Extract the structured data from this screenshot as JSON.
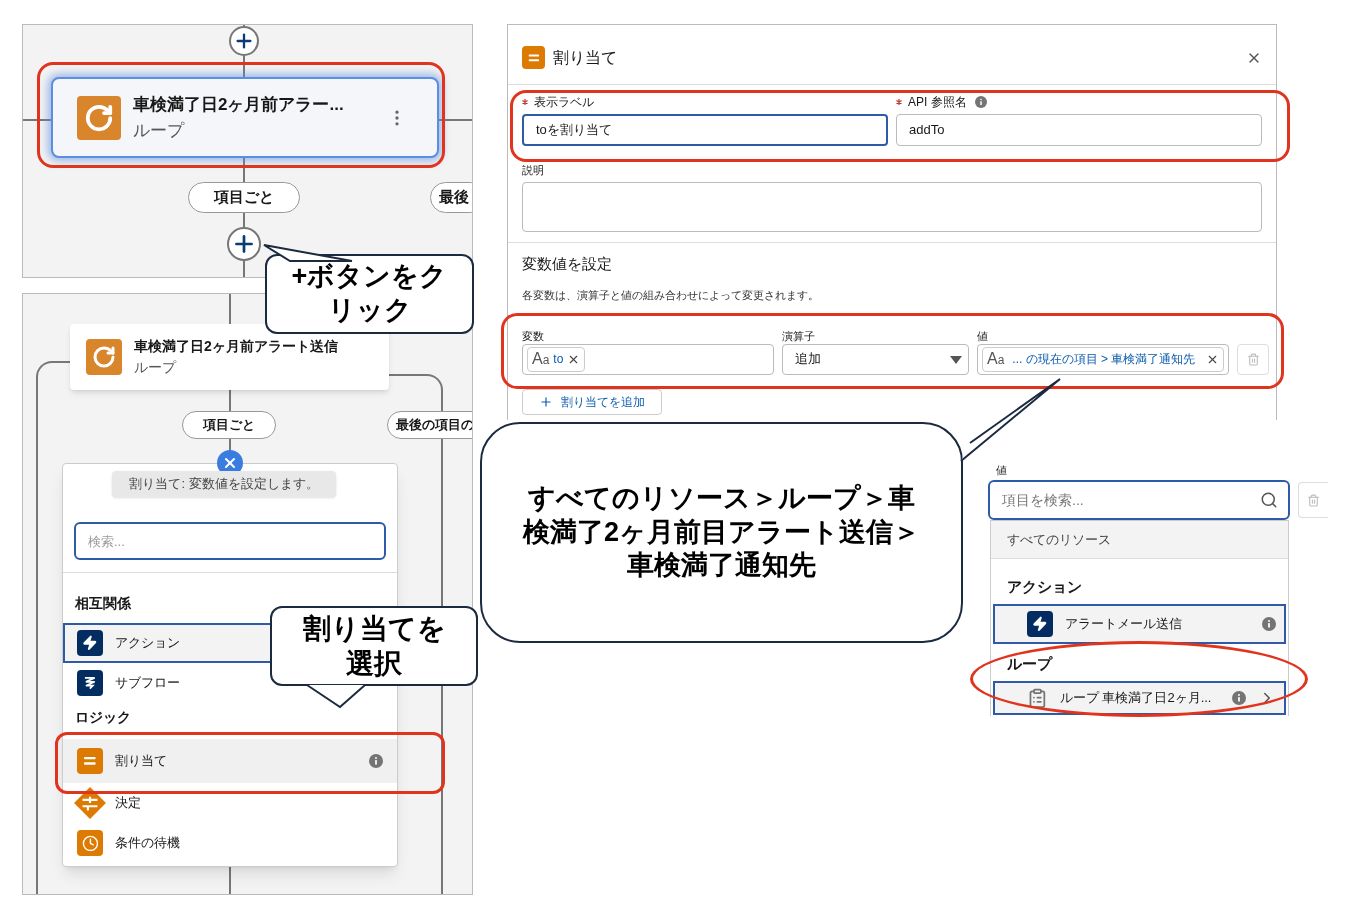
{
  "flow_top": {
    "node": {
      "title": "車検満了日2ヶ月前アラー...",
      "type": "ループ",
      "selected": true
    },
    "branches": [
      "項目ごと",
      "最後"
    ]
  },
  "callout_click": "+ボタンをクリック",
  "flow_menu": {
    "node": {
      "title": "車検満了日2ヶ月前アラート送信",
      "type": "ループ"
    },
    "branches": [
      "項目ごと",
      "最後の項目の"
    ],
    "tooltip": "割り当て: 変数値を設定します。",
    "search": {
      "placeholder": "検索..."
    },
    "sections": [
      {
        "title": "相互関係",
        "items": [
          {
            "label": "アクション",
            "kind": "bolt",
            "selected": true,
            "highlighted": false,
            "info": false
          },
          {
            "label": "サブフロー",
            "kind": "subflow",
            "selected": false,
            "highlighted": false,
            "info": false
          }
        ]
      },
      {
        "title": "ロジック",
        "items": [
          {
            "label": "割り当て",
            "kind": "assign",
            "selected": false,
            "highlighted": true,
            "info": true
          },
          {
            "label": "決定",
            "kind": "decision",
            "selected": false,
            "highlighted": false,
            "info": false
          },
          {
            "label": "条件の待機",
            "kind": "wait",
            "selected": false,
            "highlighted": false,
            "info": false
          }
        ]
      }
    ]
  },
  "callout_select": "割り当てを選択",
  "editor": {
    "title": "割り当て",
    "fields": [
      {
        "label": "表示ラベル",
        "value": "toを割り当て",
        "required": true,
        "focused": true,
        "info": false
      },
      {
        "label": "API 参照名",
        "value": "addTo",
        "required": true,
        "focused": false,
        "info": true
      }
    ],
    "description_label": "説明",
    "section_title": "変数値を設定",
    "section_hint": "各変数は、演算子と値の組み合わせによって変更されます。",
    "columns": [
      "変数",
      "演算子",
      "値"
    ],
    "row": {
      "variable_glyph": "Aa",
      "variable": "to",
      "operator": "追加",
      "value_glyph": "Aa",
      "value": "... の現在の項目 > 車検満了通知先"
    },
    "add_button": "割り当てを追加"
  },
  "callout_path": "すべてのリソース＞ループ＞車検満了2ヶ月前目アラート送信＞車検満了通知先",
  "picker": {
    "label": "値",
    "search": {
      "placeholder": "項目を検索..."
    },
    "breadcrumb": "すべてのリソース",
    "groups": [
      {
        "title": "アクション",
        "items": [
          {
            "label": "アラートメール送信",
            "kind": "bolt",
            "info": true,
            "expandable": false
          }
        ]
      },
      {
        "title": "ループ",
        "items": [
          {
            "label": "ループ 車検満了日2ヶ月...",
            "kind": "clipboard",
            "info": true,
            "expandable": true
          }
        ]
      }
    ]
  }
}
